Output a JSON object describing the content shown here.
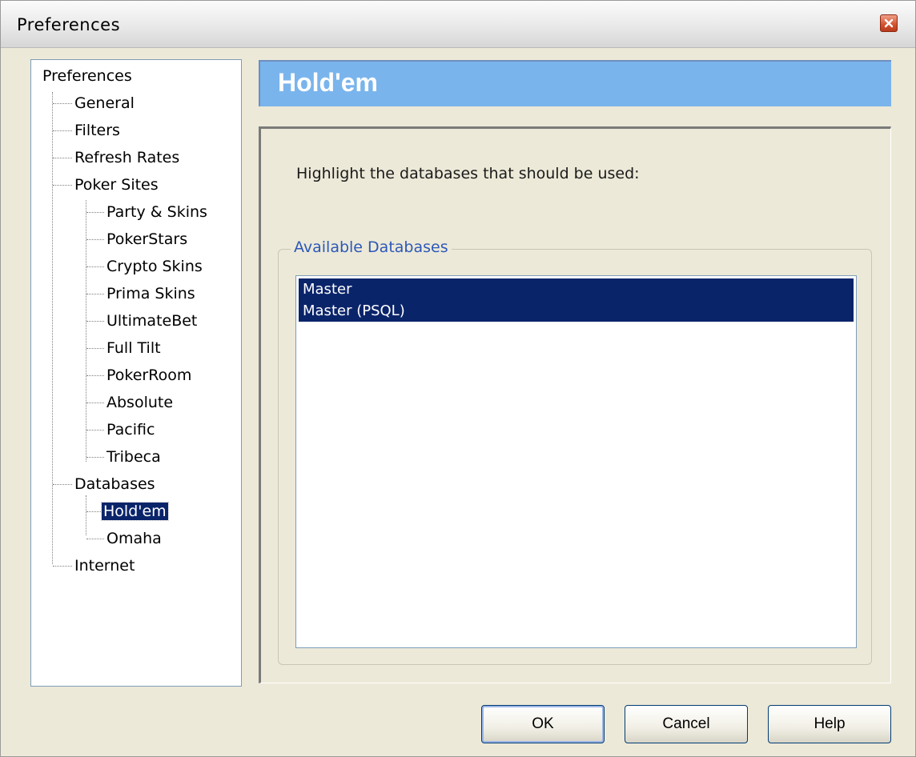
{
  "window": {
    "title": "Preferences"
  },
  "tree": {
    "items": [
      {
        "label": "Preferences"
      },
      {
        "label": "General"
      },
      {
        "label": "Filters"
      },
      {
        "label": "Refresh Rates"
      },
      {
        "label": "Poker Sites"
      },
      {
        "label": "Party & Skins"
      },
      {
        "label": "PokerStars"
      },
      {
        "label": "Crypto Skins"
      },
      {
        "label": "Prima Skins"
      },
      {
        "label": "UltimateBet"
      },
      {
        "label": "Full Tilt"
      },
      {
        "label": "PokerRoom"
      },
      {
        "label": "Absolute"
      },
      {
        "label": "Pacific"
      },
      {
        "label": "Tribeca"
      },
      {
        "label": "Databases"
      },
      {
        "label": "Hold'em",
        "selected": true
      },
      {
        "label": "Omaha"
      },
      {
        "label": "Internet"
      }
    ]
  },
  "panel": {
    "header": "Hold'em",
    "instruction": "Highlight the databases that should be used:",
    "group_label": "Available Databases",
    "databases": [
      {
        "name": "Master",
        "selected": true
      },
      {
        "name": "Master (PSQL)",
        "selected": true
      }
    ]
  },
  "buttons": {
    "ok": "OK",
    "cancel": "Cancel",
    "help": "Help"
  },
  "colors": {
    "selection": "#0a246a",
    "header_banner": "#7ab4ec",
    "group_label": "#2d58b8"
  }
}
